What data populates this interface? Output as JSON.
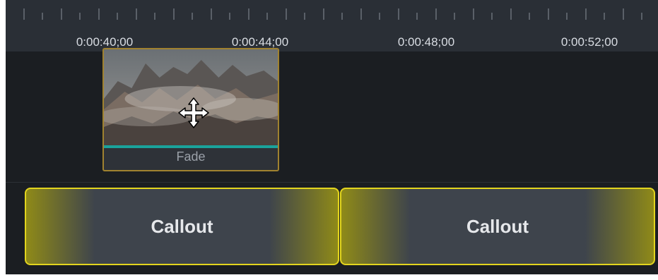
{
  "ruler": {
    "labels": [
      "0:00:40;00",
      "0:00:44;00",
      "0:00:48;00",
      "0:00:52;00"
    ]
  },
  "media_clip": {
    "label": "Fade",
    "icon": "move-cursor-icon"
  },
  "callouts": [
    {
      "label": "Callout"
    },
    {
      "label": "Callout"
    }
  ],
  "colors": {
    "background": "#1b1e22",
    "ruler": "#2a2f36",
    "selection_border": "#a0822f",
    "callout_border": "#e3d51e",
    "transition_line": "#1aa39b"
  }
}
